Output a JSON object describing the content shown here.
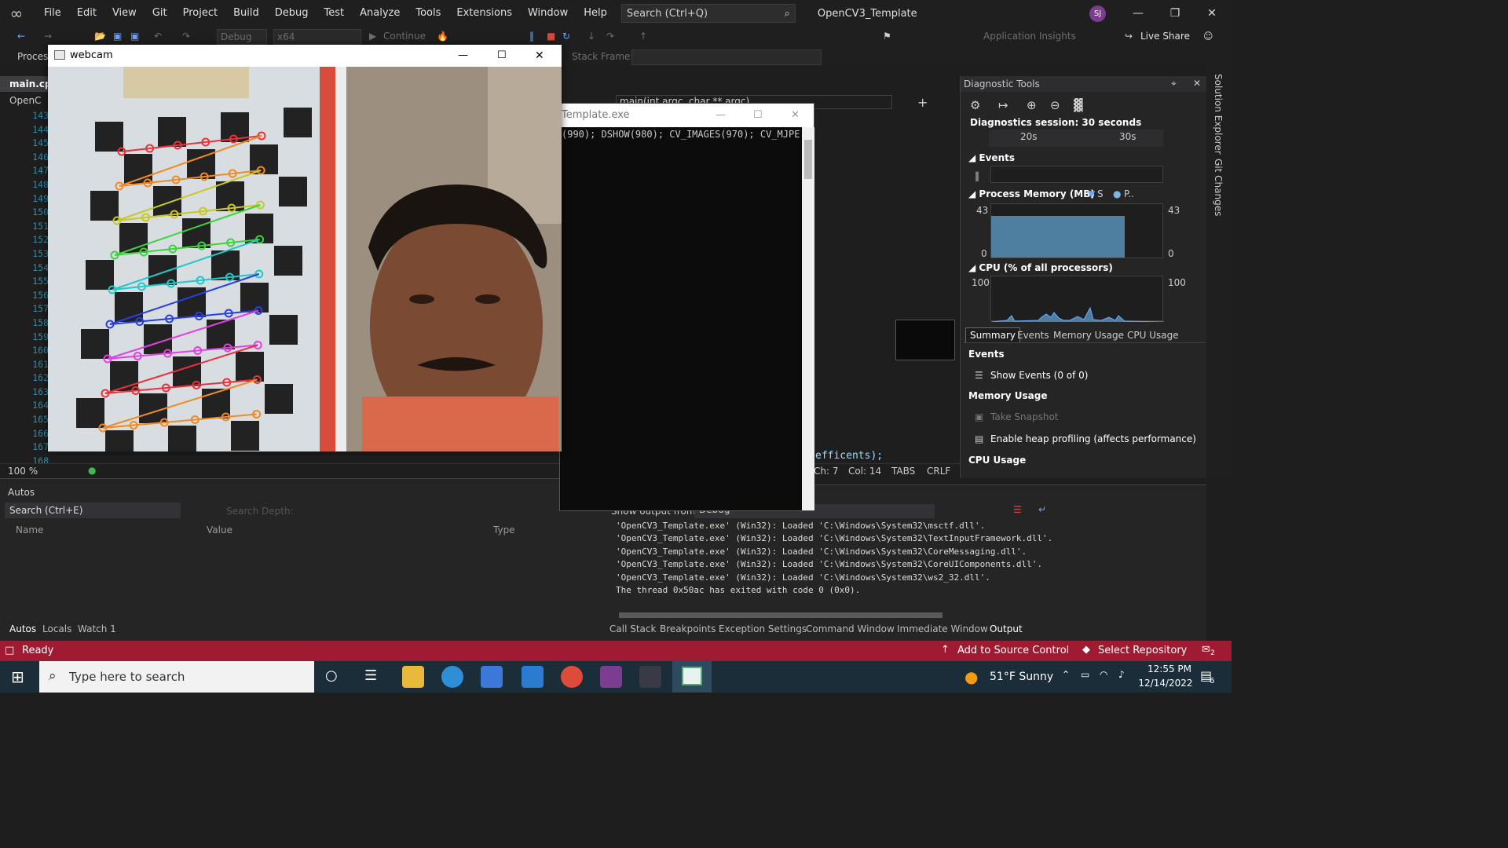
{
  "titlebar": {
    "menus": [
      "File",
      "Edit",
      "View",
      "Git",
      "Project",
      "Build",
      "Debug",
      "Test",
      "Analyze",
      "Tools",
      "Extensions",
      "Window",
      "Help"
    ],
    "search_placeholder": "Search (Ctrl+Q)",
    "solution_title": "OpenCV3_Template",
    "user_initials": "SJ"
  },
  "toolbar": {
    "config": "Debug",
    "platform": "x64",
    "continue_label": "Continue",
    "app_insights": "Application Insights",
    "live_share": "Live Share",
    "process_label": "Process",
    "stack_frame_label": "Stack Frame:"
  },
  "editor": {
    "tab_label": "main.cpp",
    "project_dropdown": "OpenC",
    "function_dropdown": "main(int argc, char ** argc)",
    "line_numbers": [
      "143",
      "144",
      "145",
      "146",
      "147",
      "148",
      "149",
      "150",
      "151",
      "152",
      "153",
      "154",
      "155",
      "156",
      "157",
      "158",
      "159",
      "160",
      "161",
      "162",
      "163",
      "164",
      "165",
      "166",
      "167",
      "168"
    ],
    "zoom": "100 %",
    "visible_code_tail": "efficents);",
    "status": {
      "ch": "Ch: 7",
      "col": "Col: 14",
      "tabs": "TABS",
      "eol": "CRLF"
    }
  },
  "webcam": {
    "title": "webcam"
  },
  "console": {
    "title": "Template.exe",
    "first_line": "(990); DSHOW(980); CV_IMAGES(970); CV_MJPE"
  },
  "diagnostics": {
    "title": "Diagnostic Tools",
    "session": "Diagnostics session: 30 seconds",
    "timeline_ticks": [
      "20s",
      "30s"
    ],
    "events_header": "Events",
    "memory_header": "Process Memory (MB)",
    "memory_legend": [
      "S",
      "P.."
    ],
    "memory_max": "43",
    "memory_min": "0",
    "memory_level": 0.78,
    "cpu_header": "CPU (% of all processors)",
    "cpu_max": "100",
    "tabs": [
      "Summary",
      "Events",
      "Memory Usage",
      "CPU Usage"
    ],
    "summary": {
      "events_title": "Events",
      "show_events": "Show Events (0 of 0)",
      "memory_title": "Memory Usage",
      "take_snapshot": "Take Snapshot",
      "heap_profiling": "Enable heap profiling (affects performance)",
      "cpu_title": "CPU Usage"
    }
  },
  "autos": {
    "title": "Autos",
    "search_placeholder": "Search (Ctrl+E)",
    "search_depth": "Search Depth:",
    "columns": [
      "Name",
      "Value",
      "Type"
    ],
    "tabs": [
      "Autos",
      "Locals",
      "Watch 1"
    ]
  },
  "output": {
    "show_from_label": "Show output from:",
    "source": "Debug",
    "lines": [
      "'OpenCV3_Template.exe' (Win32): Loaded 'C:\\Windows\\System32\\msctf.dll'.",
      "'OpenCV3_Template.exe' (Win32): Loaded 'C:\\Windows\\System32\\TextInputFramework.dll'.",
      "'OpenCV3_Template.exe' (Win32): Loaded 'C:\\Windows\\System32\\CoreMessaging.dll'.",
      "'OpenCV3_Template.exe' (Win32): Loaded 'C:\\Windows\\System32\\CoreUIComponents.dll'.",
      "'OpenCV3_Template.exe' (Win32): Loaded 'C:\\Windows\\System32\\ws2_32.dll'.",
      "The thread 0x50ac has exited with code 0 (0x0)."
    ],
    "tabs": [
      "Call Stack",
      "Breakpoints",
      "Exception Settings",
      "Command Window",
      "Immediate Window",
      "Output"
    ]
  },
  "statusbar": {
    "ready": "Ready",
    "source_control": "Add to Source Control",
    "repository": "Select Repository",
    "notifications": "2"
  },
  "taskbar": {
    "search_placeholder": "Type here to search",
    "weather": "51°F  Sunny",
    "time": "12:55 PM",
    "date": "12/14/2022",
    "notification_count": "6"
  },
  "side_tabs": [
    "Solution Explorer",
    "Git Changes"
  ],
  "colors": {
    "accent_status": "#9e1b32",
    "vs_purple": "#7a3d8f",
    "memory_fill": "#4e7fa0"
  }
}
